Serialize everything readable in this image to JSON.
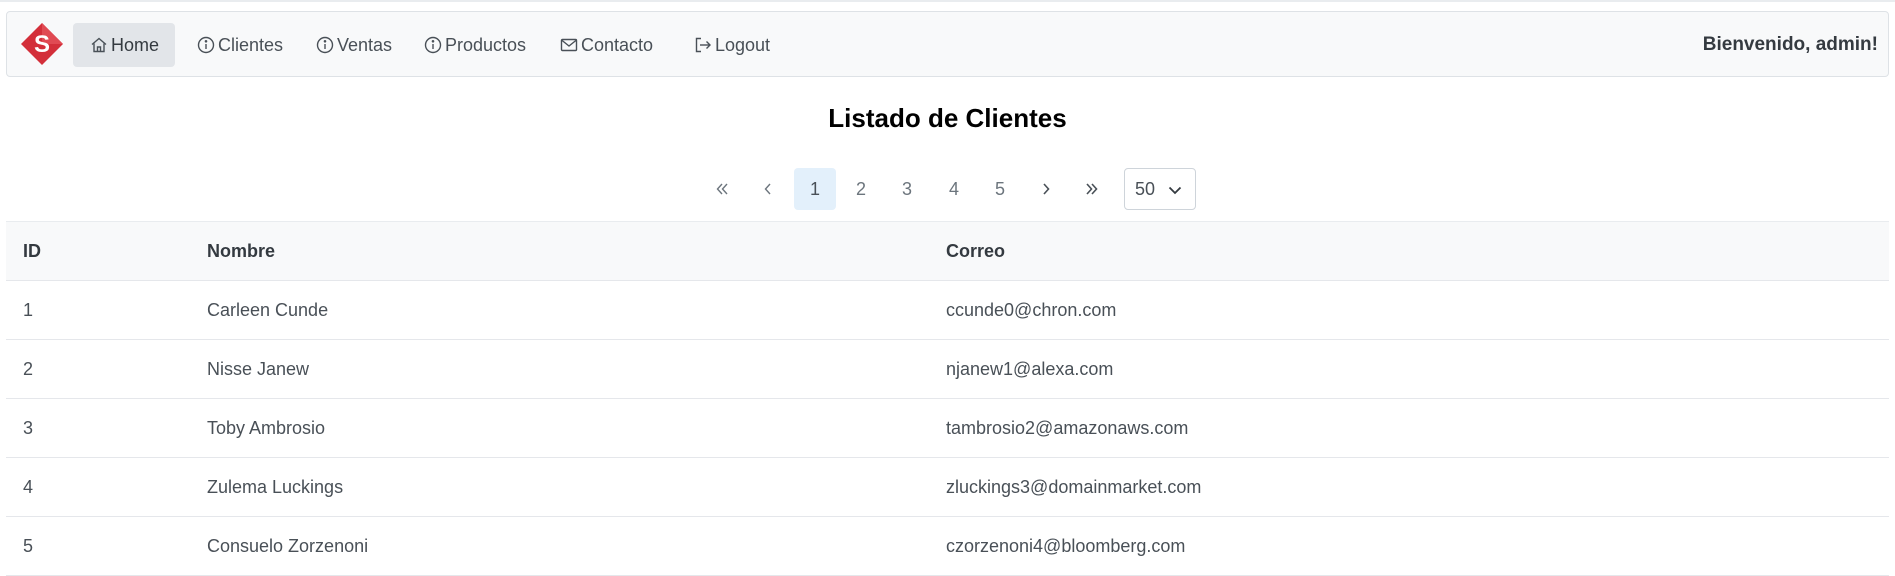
{
  "brand": {
    "logo_letter": "S",
    "logo_color": "#d32f3a"
  },
  "nav": {
    "items": [
      {
        "label": "Home",
        "icon": "home-icon",
        "active": true
      },
      {
        "label": "Clientes",
        "icon": "info-icon",
        "active": false
      },
      {
        "label": "Ventas",
        "icon": "info-icon",
        "active": false
      },
      {
        "label": "Productos",
        "icon": "info-icon",
        "active": false
      },
      {
        "label": "Contacto",
        "icon": "mail-icon",
        "active": false
      },
      {
        "label": "Logout",
        "icon": "logout-icon",
        "active": false
      }
    ],
    "welcome": "Bienvenido, admin!"
  },
  "page": {
    "title": "Listado de Clientes"
  },
  "pagination": {
    "pages": [
      "1",
      "2",
      "3",
      "4",
      "5"
    ],
    "current": "1",
    "page_size": "50"
  },
  "table": {
    "headers": [
      "ID",
      "Nombre",
      "Correo"
    ],
    "rows": [
      [
        "1",
        "Carleen Cunde",
        "ccunde0@chron.com"
      ],
      [
        "2",
        "Nisse Janew",
        "njanew1@alexa.com"
      ],
      [
        "3",
        "Toby Ambrosio",
        "tambrosio2@amazonaws.com"
      ],
      [
        "4",
        "Zulema Luckings",
        "zluckings3@domainmarket.com"
      ],
      [
        "5",
        "Consuelo Zorzenoni",
        "czorzenoni4@bloomberg.com"
      ]
    ]
  }
}
